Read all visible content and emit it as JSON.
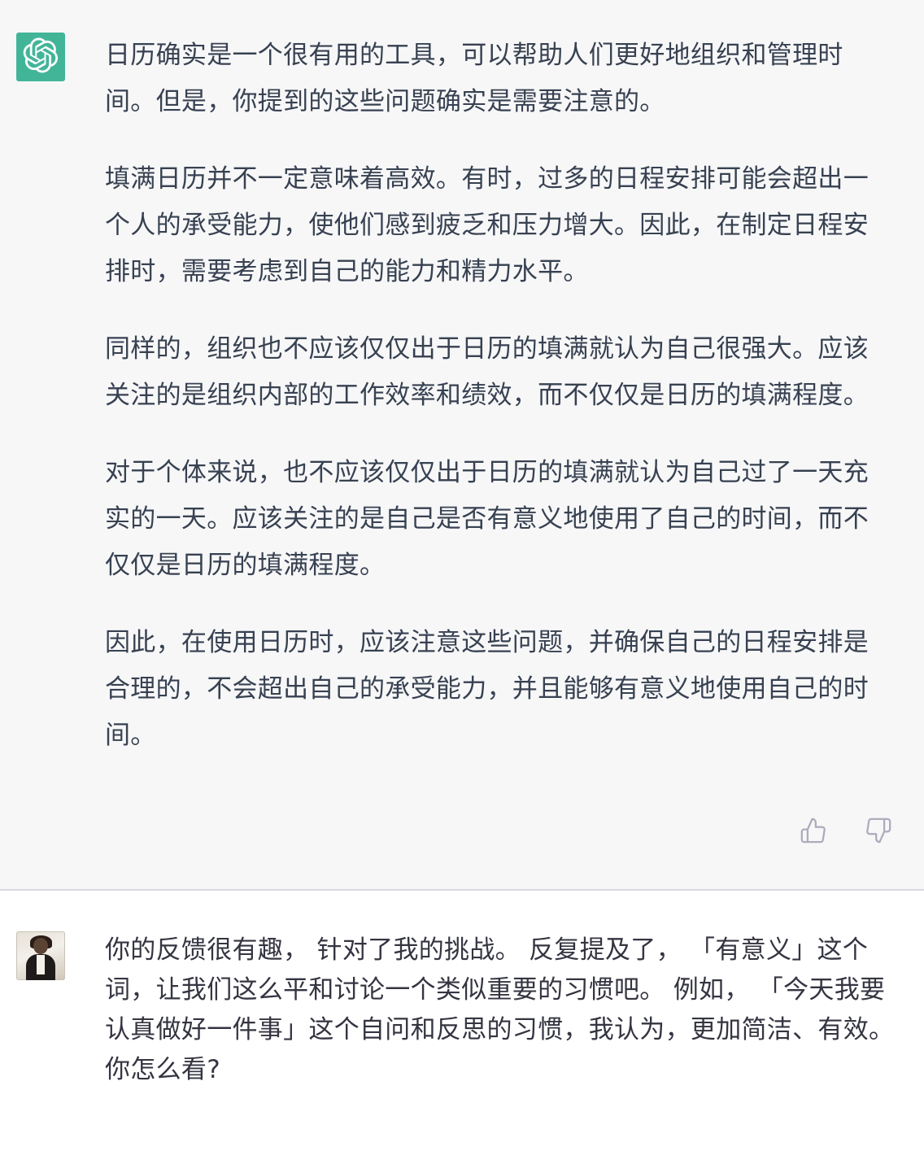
{
  "assistant": {
    "avatar_icon": "openai-logo-icon",
    "paragraphs": [
      "日历确实是一个很有用的工具，可以帮助人们更好地组织和管理时间。但是，你提到的这些问题确实是需要注意的。",
      "填满日历并不一定意味着高效。有时，过多的日程安排可能会超出一个人的承受能力，使他们感到疲乏和压力增大。因此，在制定日程安排时，需要考虑到自己的能力和精力水平。",
      "同样的，组织也不应该仅仅出于日历的填满就认为自己很强大。应该关注的是组织内部的工作效率和绩效，而不仅仅是日历的填满程度。",
      "对于个体来说，也不应该仅仅出于日历的填满就认为自己过了一天充实的一天。应该关注的是自己是否有意义地使用了自己的时间，而不仅仅是日历的填满程度。",
      "因此，在使用日历时，应该注意这些问题，并确保自己的日程安排是合理的，不会超出自己的承受能力，并且能够有意义地使用自己的时间。"
    ],
    "feedback": {
      "like_icon": "thumbs-up-icon",
      "dislike_icon": "thumbs-down-icon"
    }
  },
  "user": {
    "avatar": "user-avatar",
    "message": "你的反馈很有趣， 针对了我的挑战。 反复提及了， 「有意义」这个词，让我们这么平和讨论一个类似重要的习惯吧。 例如， 「今天我要认真做好一件事」这个自问和反思的习惯，我认为，更加简洁、有效。 你怎么看?"
  },
  "colors": {
    "assistant_background": "#f7f7f8",
    "user_background": "#ffffff",
    "brand_green": "#10a37f",
    "text": "#374151",
    "icon": "#acacbe"
  }
}
